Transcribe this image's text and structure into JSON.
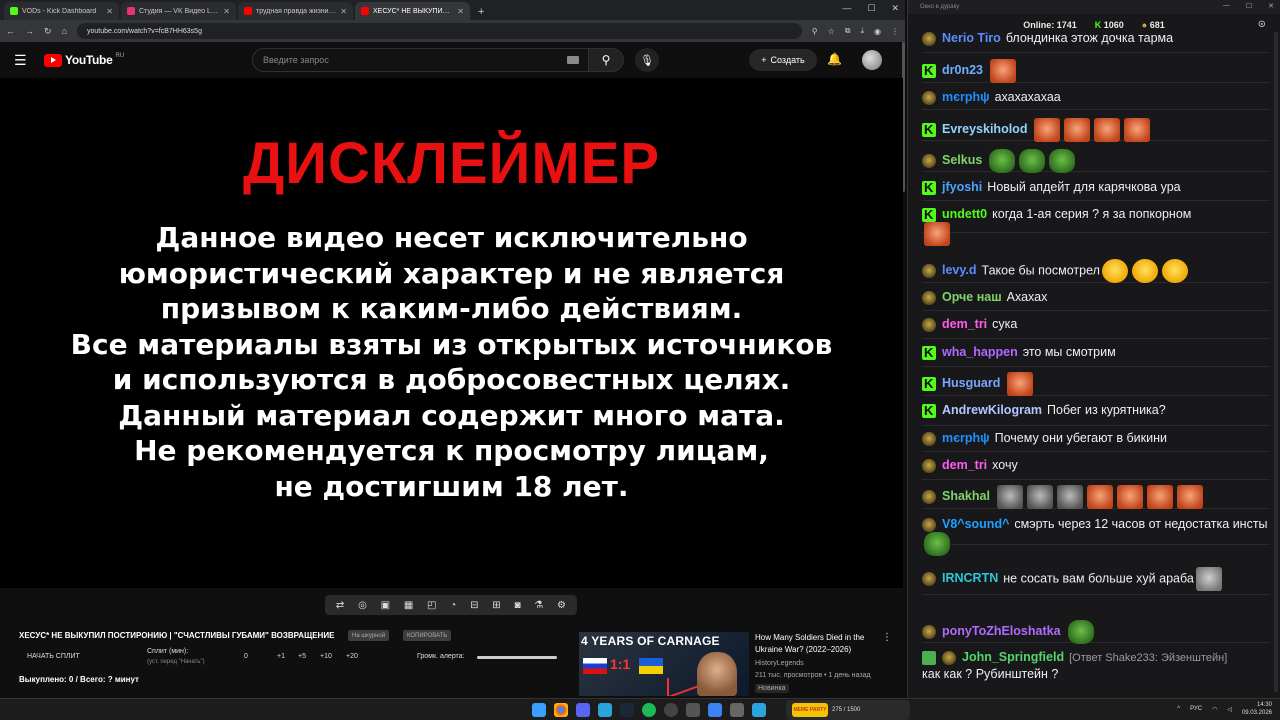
{
  "browser": {
    "tabs": [
      {
        "title": "VODs - Kick Dashboard",
        "color": "#53fc18"
      },
      {
        "title": "Студия — VK Видео Live",
        "color": "#e8336d"
      },
      {
        "title": "трудная правда жизни... - You",
        "color": "#ff0000"
      },
      {
        "title": "ХЕСУС* НЕ ВЫКУПИЛ ПОСТИ",
        "color": "#ff0000"
      }
    ],
    "url": "youtube.com/watch?v=fcB7HH63s5g"
  },
  "youtube": {
    "logo_text": "YouTube",
    "region": "RU",
    "search_placeholder": "Введите запрос",
    "create_label": "Создать"
  },
  "video": {
    "title": "ДИСКЛЕЙМЕР",
    "lines": [
      "Данное видео несет исключительно",
      "юмористический характер и не является",
      "призывом к каким-либо действиям.",
      "Все материалы взяты из открытых источников",
      "и используются в добросовестных целях.",
      "Данный материал содержит много мата.",
      "Не рекомендуется к просмотру лицам,",
      "не достигшим 18 лет."
    ]
  },
  "panel": {
    "video_title": "ХЕСУС* НЕ ВЫКУПИЛ ПОСТИРОНИЮ | \"СЧАСТЛИВЫ ГУБАМИ\" ВОЗВРАЩЕНИЕ",
    "pill1": "На шкурной",
    "pill2": "КОПИРОВАТЬ",
    "split_label": "НАЧАТЬ СПЛИТ",
    "split_min": "Сплит (мин):",
    "split_sub": "(уст. перед \"Начать\")",
    "numbers": [
      "0",
      "+1",
      "+5",
      "+10",
      "+20"
    ],
    "alert_label": "Громк. алерта:",
    "killed": "Выкуплено: 0 / Всего: ? минут",
    "alert_volume": 1.0
  },
  "recommended": {
    "thumb_title": "4 YEARS OF CARNAGE",
    "score": "1:1",
    "title": "How Many Soldiers Died in the Ukraine War? (2022–2026)",
    "channel": "HistoryLegends",
    "meta": "211 тыс. просмотров • 1 день назад",
    "badge": "Новинка"
  },
  "chat": {
    "window_title": "Окно в дураку",
    "online": "Online: 1741",
    "kick_count": "1060",
    "other_count": "681",
    "messages": [
      {
        "badge": "pepe",
        "user": "Nerio Tiro",
        "color": "#5b8cff",
        "text": "блондинка этож дочка тарма",
        "emotes": []
      },
      {
        "badge": "kick",
        "user": "dr0n23",
        "color": "#6ab0ff",
        "text": "",
        "emotes": [
          "face"
        ]
      },
      {
        "badge": "pepe",
        "user": "mєrphψ",
        "color": "#1e90ff",
        "text": "ахахахахаа",
        "emotes": []
      },
      {
        "badge": "kick",
        "user": "Evreyskiholod",
        "color": "#8fd3ff",
        "text": "",
        "emotes": [
          "face",
          "face",
          "face",
          "face"
        ]
      },
      {
        "badge": "pepe",
        "user": "Selkus",
        "color": "#7fd46a",
        "text": "",
        "emotes": [
          "pepe",
          "pepe",
          "pepe"
        ]
      },
      {
        "badge": "kick",
        "user": "jfyoshi",
        "color": "#4aa3ff",
        "text": "Новый апдейт для карячкова ура",
        "emotes": []
      },
      {
        "badge": "kick",
        "user": "undett0",
        "color": "#53fc18",
        "text": "когда 1-ая серия ? я за попкорном",
        "emotes": [
          "face"
        ]
      },
      {
        "badge": "pepe",
        "user": "levy.d",
        "color": "#5b8cff",
        "text": "Такое бы посмотрел",
        "emotes": [
          "laugh",
          "laugh",
          "laugh"
        ]
      },
      {
        "badge": "pepe",
        "user": "Орче наш",
        "color": "#7fd46a",
        "text": "Ахахах",
        "emotes": []
      },
      {
        "badge": "pepe",
        "user": "dem_tri",
        "color": "#ff5cf0",
        "text": "сука",
        "emotes": []
      },
      {
        "badge": "kick",
        "user": "wha_happen",
        "color": "#b06aff",
        "text": "это мы смотрим",
        "emotes": []
      },
      {
        "badge": "kick",
        "user": "Husguard",
        "color": "#7aa7ff",
        "text": "",
        "emotes": [
          "face"
        ]
      },
      {
        "badge": "kick",
        "user": "AndrewKilogram",
        "color": "#b0c8ff",
        "text": "Побег из курятника?",
        "emotes": []
      },
      {
        "badge": "pepe",
        "user": "mєrphψ",
        "color": "#1e90ff",
        "text": "Почему они убегают в бикини",
        "emotes": []
      },
      {
        "badge": "pepe",
        "user": "dem_tri",
        "color": "#ff5cf0",
        "text": "хочу",
        "emotes": []
      },
      {
        "badge": "pepe",
        "user": "Shakhal",
        "color": "#7fd46a",
        "text": "",
        "emotes": [
          "cat",
          "cat",
          "cat",
          "face",
          "face",
          "face",
          "face"
        ]
      },
      {
        "badge": "pepe",
        "user": "V8^sound^",
        "color": "#1fa0ff",
        "text": "смэрть через 12 часов от недостатка инсты",
        "emotes": [
          "pepe"
        ]
      },
      {
        "badge": "pepe",
        "user": "IRNCRTN",
        "color": "#2dc7d8",
        "text": "не сосать вам больше хуй араба",
        "emotes": [
          "grey"
        ]
      },
      {
        "badge": "pepe",
        "user": "ponyToZhEloshatka",
        "color": "#b06aff",
        "text": "",
        "emotes": [
          "pepe"
        ]
      },
      {
        "badge": "check",
        "user": "John_Springfield",
        "color": "#53d66a",
        "reply": "[Ответ Shake233: Эйзенштейн]",
        "text": "как как ? Рубинштейн ?",
        "emotes": []
      }
    ]
  },
  "taskbar": {
    "lang": "РУС",
    "time": "14:30",
    "date": "09.03.2026",
    "widget_text": "275 / 1500",
    "widget_label": "MEME PARTY"
  }
}
